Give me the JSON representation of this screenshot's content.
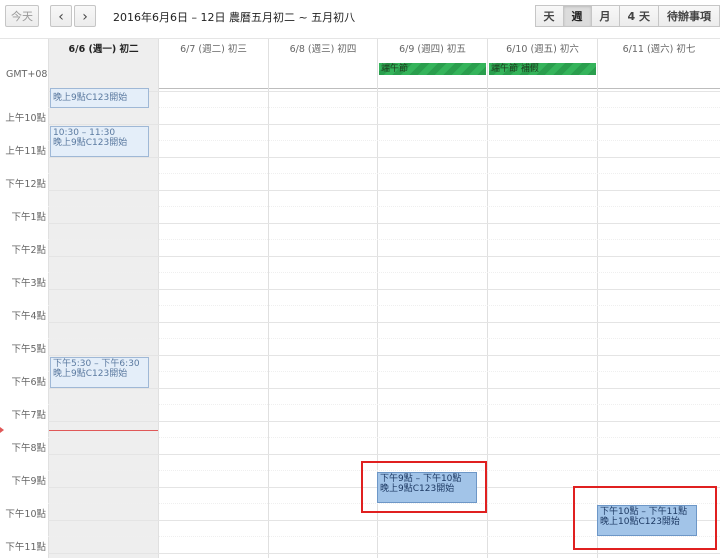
{
  "toolbar": {
    "today_label": "今天",
    "prev_label": "‹",
    "next_label": "›",
    "range_title": "2016年6月6日 – 12日 農曆五月初二 ~ 五月初八",
    "views": [
      "天",
      "週",
      "月",
      "4 天",
      "待辦事項"
    ],
    "active_view": "週"
  },
  "timezone_label": "GMT+08",
  "days": [
    {
      "label": "6/6 (週一) 初二",
      "today": true
    },
    {
      "label": "6/7 (週二) 初三",
      "today": false
    },
    {
      "label": "6/8 (週三) 初四",
      "today": false
    },
    {
      "label": "6/9 (週四) 初五",
      "today": false
    },
    {
      "label": "6/10 (週五) 初六",
      "today": false
    },
    {
      "label": "6/11 (週六) 初七",
      "today": false
    }
  ],
  "allday_events": [
    {
      "title": "端午節",
      "day": 3
    },
    {
      "title": "端午節 補假",
      "day": 4
    }
  ],
  "hours": [
    "上午10點",
    "上午11點",
    "下午12點",
    "下午1點",
    "下午2點",
    "下午3點",
    "下午4點",
    "下午5點",
    "下午6點",
    "下午7點",
    "下午8點",
    "下午9點",
    "下午10點",
    "下午11點"
  ],
  "events": [
    {
      "time": "",
      "title": "晚上9點C123開始",
      "day": 0,
      "style": "light"
    },
    {
      "time": "10:30 – 11:30",
      "title": "晚上9點C123開始",
      "day": 0,
      "style": "light"
    },
    {
      "time": "下午5:30 – 下午6:30",
      "title": "晚上9點C123開始",
      "day": 0,
      "style": "light"
    },
    {
      "time": "下午9點 – 下午10點",
      "title": "晚上9點C123開始",
      "day": 3,
      "style": "dark"
    },
    {
      "time": "下午10點 – 下午11點",
      "title": "晚上10點C123開始",
      "day": 5,
      "style": "dark"
    }
  ],
  "colors": {
    "holiday": "#35b45b",
    "event_light": "#e4eef9",
    "event_dark": "#a2c4e8",
    "now_line": "#e05858",
    "highlight": "#e02020"
  }
}
